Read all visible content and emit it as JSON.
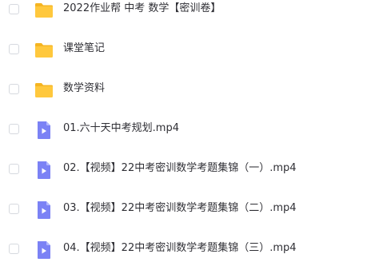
{
  "file_list": {
    "items": [
      {
        "type": "folder",
        "icon": "folder-icon",
        "name": "2022作业帮 中考 数学【密训卷】"
      },
      {
        "type": "folder",
        "icon": "folder-icon",
        "name": "课堂笔记"
      },
      {
        "type": "folder",
        "icon": "folder-icon",
        "name": "数学资料"
      },
      {
        "type": "video",
        "icon": "video-file-icon",
        "name": "01.六十天中考规划.mp4"
      },
      {
        "type": "video",
        "icon": "video-file-icon",
        "name": "02.【视频】22中考密训数学考题集锦（一）.mp4"
      },
      {
        "type": "video",
        "icon": "video-file-icon",
        "name": "03.【视频】22中考密训数学考题集锦（二）.mp4"
      },
      {
        "type": "video",
        "icon": "video-file-icon",
        "name": "04.【视频】22中考密训数学考题集锦（三）.mp4"
      }
    ]
  },
  "colors": {
    "folder": "#ffc83d",
    "folder_tab": "#f5b522",
    "video": "#7b82f5",
    "video_fold": "#b3b8ff",
    "text": "#2f2f35",
    "checkbox_border": "#d6d9df"
  }
}
